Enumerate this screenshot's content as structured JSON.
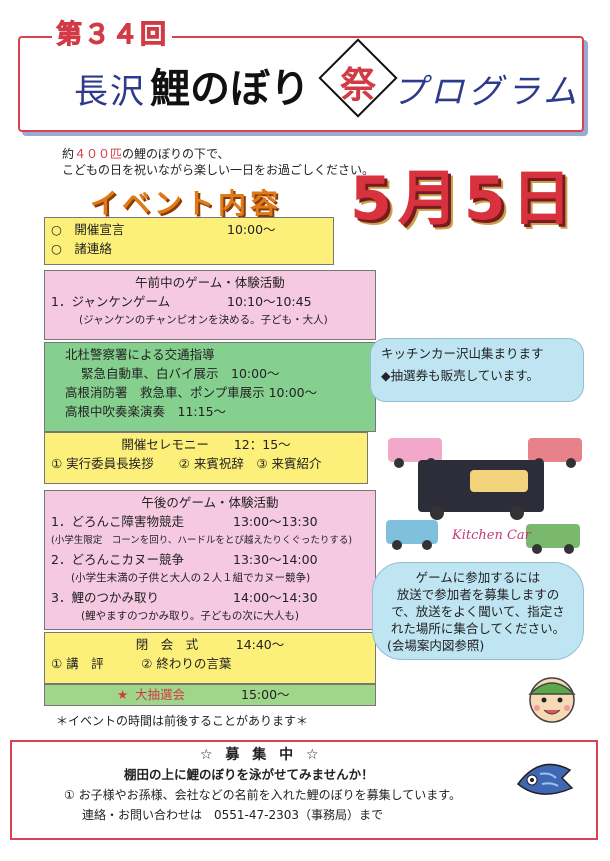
{
  "header": {
    "edition": "第３４回",
    "title_place": "長沢",
    "title_main": "鯉のぼり",
    "title_fest": "祭",
    "title_program": "プログラム"
  },
  "intro": {
    "line1_pre": "約",
    "line1_count": "４００匹",
    "line1_post": "の鯉のぼりの下で、",
    "line2": "こどもの日を祝いながら楽しい一日をお過ごしください。"
  },
  "date": "5月5日",
  "event_heading": "イベント内容",
  "program": {
    "opening": {
      "items": [
        {
          "label": "○　開催宣言",
          "time": "10:00～"
        },
        {
          "label": "○　諸連絡",
          "time": ""
        }
      ]
    },
    "morning": {
      "title": "午前中のゲーム・体験活動",
      "item": "1．ジャンケンゲーム",
      "time": "10:10～10:45",
      "note": "(ジャンケンのチャンピオンを決める。子ども・大人)"
    },
    "traffic": {
      "title": "北杜警察署による交通指導",
      "lines": [
        "緊急自動車、白バイ展示　10:00～",
        "高根消防署　救急車、ポンプ車展示 10:00～",
        "高根中吹奏楽演奏　11:15～"
      ]
    },
    "ceremony": {
      "title": "開催セレモニー　　12：15～",
      "line": "① 実行委員長挨拶　　② 来賓祝辞　③ 来賓紹介"
    },
    "afternoon": {
      "title": "午後のゲーム・体験活動",
      "items": [
        {
          "label": "1．どろんこ障害物競走",
          "time": "13:00～13:30",
          "note": "(小学生限定　コーンを回り、ハードルをとび越えたりくぐったりする)"
        },
        {
          "label": "2．どろんこカヌー競争",
          "time": "13:30～14:00",
          "note": "(小学生未満の子供と大人の２人１組でカヌー競争)"
        },
        {
          "label": "3．鯉のつかみ取り",
          "time": "14:00～14:30",
          "note": "(鯉やますのつかみ取り。子どもの次に大人も)"
        }
      ]
    },
    "closing": {
      "title": "閉　会　式　　　14:40～",
      "line": "① 講　評　　　② 終わりの言葉"
    },
    "lottery": {
      "star": "★",
      "label": "大抽選会",
      "time": "15:00～"
    }
  },
  "note": "＊イベントの時間は前後することがあります＊",
  "kitchen_bubble": {
    "line1": "キッチンカー沢山集まります",
    "line2": "◆抽選券も販売しています。"
  },
  "kitchen_car_label": "Kitchen Car",
  "game_bubble": {
    "lines": [
      "ゲームに参加するには",
      "放送で参加者を募集しますの",
      "で、放送をよく聞いて、指定さ",
      "れた場所に集合してください。",
      "(会場案内図参照)"
    ]
  },
  "recruit": {
    "title": "☆ 募 集 中 ☆",
    "subtitle": "棚田の上に鯉のぼりを泳がせてみませんか！",
    "line1": "① お子様やお孫様、会社などの名前を入れた鯉のぼりを募集しています。",
    "line2": "連絡・お問い合わせは　0551-47-2303（事務局）まで"
  },
  "colors": {
    "red": "#d23a46",
    "blue": "#2c3b8c",
    "yellow_box": "#fcf07a",
    "pink_box": "#f6c9e2",
    "green_box": "#86d08f",
    "bubble": "#bfe4f2"
  }
}
